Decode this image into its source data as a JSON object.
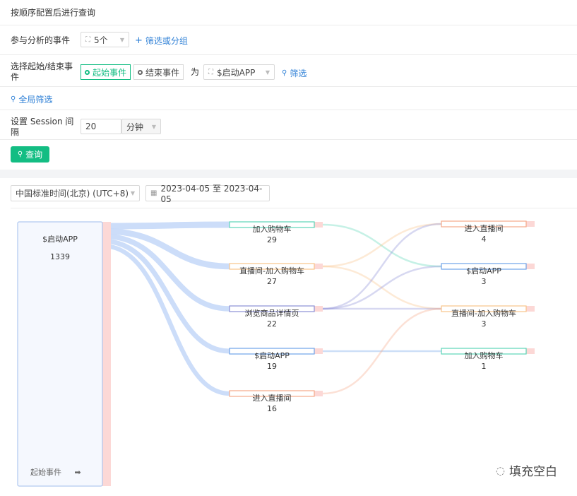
{
  "header": {
    "title": "按顺序配置后进行查询"
  },
  "events_row": {
    "label": "参与分析的事件",
    "count": "5个",
    "filter_link": "筛选或分组"
  },
  "start_end_row": {
    "label": "选择起始/结束事件",
    "start_tab": "起始事件",
    "end_tab": "结束事件",
    "is_word": "为",
    "event": "$启动APP",
    "filter_link": "筛选"
  },
  "global_filter": {
    "label": "全局筛选"
  },
  "session_row": {
    "label": "设置 Session 间隔",
    "value": "20",
    "unit": "分钟"
  },
  "query_button": {
    "label": "查询"
  },
  "toolbar": {
    "timezone": "中国标准时间(北京) (UTC+8)",
    "date_range": "2023-04-05 至 2023-04-05"
  },
  "chart_data": {
    "type": "sankey",
    "source": {
      "name": "$启动APP",
      "value": 1339,
      "footer": "起始事件"
    },
    "level1": [
      {
        "name": "加入购物车",
        "value": 29,
        "color": "#5cd6b8"
      },
      {
        "name": "直播间-加入购物车",
        "value": 27,
        "color": "#f8c48a"
      },
      {
        "name": "浏览商品详情页",
        "value": 22,
        "color": "#8b8fd6"
      },
      {
        "name": "$启动APP",
        "value": 19,
        "color": "#6fa3e8"
      },
      {
        "name": "进入直播间",
        "value": 16,
        "color": "#f5a98a"
      }
    ],
    "level2": [
      {
        "name": "进入直播间",
        "value": 4,
        "color": "#f5a98a"
      },
      {
        "name": "$启动APP",
        "value": 3,
        "color": "#6fa3e8"
      },
      {
        "name": "直播间-加入购物车",
        "value": 3,
        "color": "#f8c48a"
      },
      {
        "name": "加入购物车",
        "value": 1,
        "color": "#5cd6b8"
      }
    ],
    "links_l2": [
      [
        0,
        1
      ],
      [
        1,
        0
      ],
      [
        1,
        2
      ],
      [
        2,
        0
      ],
      [
        2,
        1
      ],
      [
        2,
        2
      ],
      [
        3,
        3
      ],
      [
        4,
        2
      ]
    ]
  },
  "watermark": {
    "text": "填充空白"
  }
}
